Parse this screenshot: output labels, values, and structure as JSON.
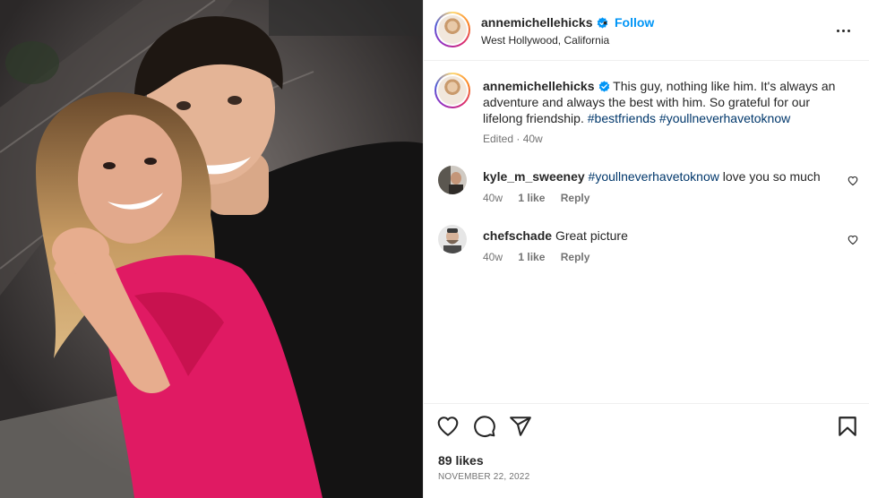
{
  "post": {
    "username": "annemichellehicks",
    "follow_label": "Follow",
    "separator": "•",
    "location": "West Hollywood, California",
    "caption_prefix": "This guy, nothing like him. It's always an adventure and always the best with him. So grateful for our lifelong friendship.",
    "caption_tag_1": "#bestfriends",
    "caption_tag_2": "#youllneverhavetoknow",
    "caption_meta": "Edited · 40w",
    "likes": "89 likes",
    "date": "November 22, 2022"
  },
  "comments": [
    {
      "username": "kyle_m_sweeney",
      "tag": "#youllneverhavetoknow",
      "text": "love you so much",
      "age": "40w",
      "likes": "1 like",
      "reply_label": "Reply"
    },
    {
      "username": "chefschade",
      "text": "Great picture",
      "age": "40w",
      "likes": "1 like",
      "reply_label": "Reply"
    }
  ],
  "icons": {
    "verified": "verified-badge-icon",
    "more": "more-options-icon",
    "like": "heart-icon",
    "comment": "comment-icon",
    "share": "share-icon",
    "save": "bookmark-icon"
  },
  "colors": {
    "accent": "#0095f6",
    "hashtag": "#00376b",
    "muted": "#737373",
    "text": "#262626",
    "dress": "#e01a63"
  }
}
